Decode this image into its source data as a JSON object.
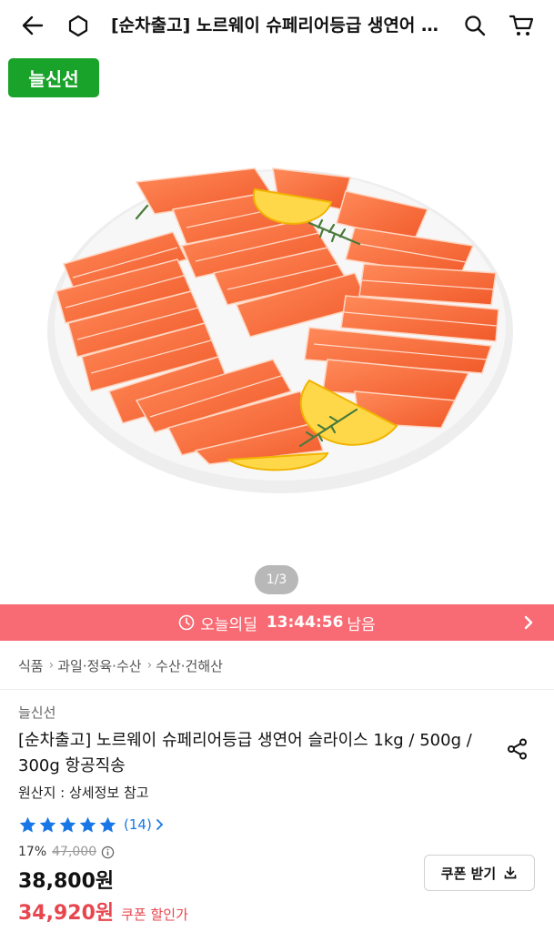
{
  "header": {
    "title": "[순차출고] 노르웨이 슈페리어등급 생연어 …",
    "back_icon": "arrow-left-icon",
    "home_icon": "home-icon",
    "search_icon": "search-icon",
    "cart_icon": "cart-icon"
  },
  "gallery": {
    "badge": "늘신선",
    "pager": "1/3"
  },
  "deal": {
    "label": "오늘의딜",
    "time": "13:44:56",
    "suffix": "남음",
    "color": "#f86b74"
  },
  "breadcrumb": [
    "식품",
    "과일·정육·수산",
    "수산·건해산"
  ],
  "product": {
    "brand": "늘신선",
    "name": "[순차출고] 노르웨이 슈페리어등급 생연어 슬라이스 1kg / 500g / 300g 항공직송",
    "origin": "원산지 : 상세정보 참고",
    "rating_stars": 5,
    "review_count": "(14)",
    "discount_rate": "17%",
    "original_price": "47,000",
    "price": "38,800원",
    "coupon_price": "34,920원",
    "coupon_price_label": "쿠폰 할인가",
    "coupon_button": "쿠폰 받기"
  },
  "colors": {
    "badge_green": "#1aa32a",
    "star_blue": "#1877e6",
    "sale_red": "#e8464f"
  }
}
